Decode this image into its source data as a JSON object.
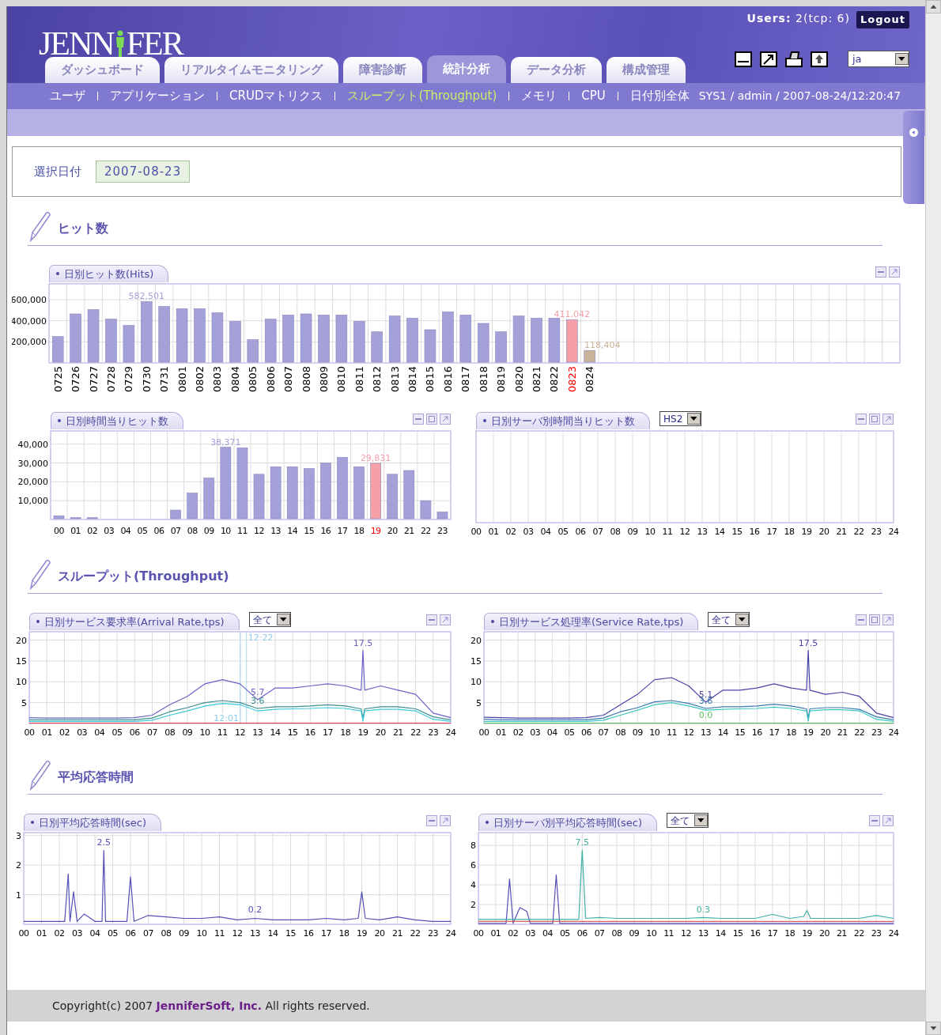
{
  "header": {
    "logo": {
      "left": "JENN",
      "right": "FER"
    },
    "users": "**Users:** 2(tcp: 6)",
    "logout": "Logout",
    "language": "ja"
  },
  "tabs": [
    {
      "label": "ダッシュボード",
      "selected": false
    },
    {
      "label": "リアルタイムモニタリング",
      "selected": false
    },
    {
      "label": "障害診断",
      "selected": false
    },
    {
      "label": "統計分析",
      "selected": true
    },
    {
      "label": "データ分析",
      "selected": false
    },
    {
      "label": "構成管理",
      "selected": false
    }
  ],
  "subnav": [
    {
      "label": "ユーザ",
      "selected": false
    },
    {
      "label": "アプリケーション",
      "selected": false
    },
    {
      "label": "CRUDマトリクス",
      "selected": false
    },
    {
      "label": "スループット(Throughput)",
      "selected": true
    },
    {
      "label": "メモリ",
      "selected": false
    },
    {
      "label": "CPU",
      "selected": false
    },
    {
      "label": "日付別全体",
      "selected": false
    }
  ],
  "session": "SYS1 / admin / 2007-08-24/12:20:47",
  "date_filter": {
    "label": "選択日付",
    "value": "2007-08-23"
  },
  "sections": [
    {
      "title": "ヒット数",
      "panels": [
        {
          "title": "日別ヒット数(Hits)",
          "buttons": [
            {
              "kind": "minimize"
            },
            {
              "kind": "maximize"
            }
          ],
          "chart_data": {
            "type": "bar",
            "stacked": true,
            "grid": true,
            "categories": [
              "0725",
              "0726",
              "0727",
              "0728",
              "0729",
              "0730",
              "0731",
              "0801",
              "0802",
              "0803",
              "0804",
              "0805",
              "0806",
              "0807",
              "0808",
              "0809",
              "0810",
              "0811",
              "0812",
              "0813",
              "0814",
              "0815",
              "0816",
              "0817",
              "0818",
              "0819",
              "0820",
              "0821",
              "0822",
              "0823",
              "0824"
            ],
            "series": [
              {
                "color": "#a4a1d8",
                "values": [
                  250000,
                  465000,
                  505000,
                  415000,
                  355000,
                  582501,
                  535000,
                  515000,
                  515000,
                  475000,
                  395000,
                  220000,
                  415000,
                  455000,
                  465000,
                  455000,
                  455000,
                  395000,
                  295000,
                  445000,
                  425000,
                  315000,
                  485000,
                  455000,
                  375000,
                  295000,
                  445000,
                  425000,
                  425000,
                  null,
                  null
                ]
              },
              {
                "color": "#f4a0a6",
                "values": [
                  null,
                  null,
                  null,
                  null,
                  null,
                  null,
                  null,
                  null,
                  null,
                  null,
                  null,
                  null,
                  null,
                  null,
                  null,
                  null,
                  null,
                  null,
                  null,
                  null,
                  null,
                  null,
                  null,
                  null,
                  null,
                  null,
                  null,
                  null,
                  null,
                  411042,
                  null
                ]
              },
              {
                "color": "#c8b498",
                "values": [
                  null,
                  null,
                  null,
                  null,
                  null,
                  null,
                  null,
                  null,
                  null,
                  null,
                  null,
                  null,
                  null,
                  null,
                  null,
                  null,
                  null,
                  null,
                  null,
                  null,
                  null,
                  null,
                  null,
                  null,
                  null,
                  null,
                  null,
                  null,
                  null,
                  null,
                  118404
                ]
              }
            ],
            "ylim": [
              0,
              750000
            ],
            "yticks": [
              {
                "value": 200000,
                "label": "200,000"
              },
              {
                "value": 400000,
                "label": "400,000"
              },
              {
                "value": 600000,
                "label": "600,000"
              }
            ],
            "annotations": [
              {
                "x": "0730",
                "y": 582501,
                "text": "582,501"
              },
              {
                "x": "0823",
                "y": 411042,
                "text": "411,042"
              },
              {
                "x": "0824",
                "y": 118404,
                "text": "118,404"
              }
            ]
          }
        },
        {
          "title": "日別時間当りヒット数",
          "buttons": [
            {
              "kind": "minimize"
            },
            {
              "kind": "restore"
            },
            {
              "kind": "maximize"
            }
          ],
          "chart_data": {
            "type": "bar",
            "stacked": true,
            "grid": true,
            "categories": [
              "00",
              "01",
              "02",
              "03",
              "04",
              "05",
              "06",
              "07",
              "08",
              "09",
              "10",
              "11",
              "12",
              "13",
              "14",
              "15",
              "16",
              "17",
              "18",
              "19",
              "20",
              "21",
              "22",
              "23"
            ],
            "series": [
              {
                "color": "#a4a1d8",
                "values": [
                  2000,
                  1000,
                  1000,
                  0,
                  0,
                  0,
                  0,
                  5000,
                  14000,
                  22000,
                  38371,
                  38000,
                  24000,
                  28000,
                  28000,
                  27000,
                  30000,
                  33000,
                  28000,
                  null,
                  24000,
                  26000,
                  10000,
                  4000
                ]
              },
              {
                "color": "#f4a0a6",
                "values": [
                  null,
                  null,
                  null,
                  null,
                  null,
                  null,
                  null,
                  null,
                  null,
                  null,
                  null,
                  null,
                  null,
                  null,
                  null,
                  null,
                  null,
                  null,
                  null,
                  29831,
                  null,
                  null,
                  null,
                  null
                ]
              }
            ],
            "ylim": [
              0,
              47000
            ],
            "yticks": [
              {
                "value": 10000,
                "label": "10,000"
              },
              {
                "value": 20000,
                "label": "20,000"
              },
              {
                "value": 30000,
                "label": "30,000"
              },
              {
                "value": 40000,
                "label": "40,000"
              }
            ],
            "annotations": [
              {
                "x": "10",
                "y": 38371,
                "text": "38,371"
              },
              {
                "x": "19",
                "y": 29831,
                "text": "29,831"
              }
            ]
          }
        },
        {
          "title": "日別サーバ別時間当りヒット数",
          "filter": "HS2",
          "buttons": [
            {
              "kind": "minimize"
            },
            {
              "kind": "restore"
            },
            {
              "kind": "maximize"
            }
          ],
          "axis_labels": [
            "00",
            "01",
            "02",
            "03",
            "04",
            "05",
            "06",
            "07",
            "08",
            "09",
            "10",
            "11",
            "12",
            "13",
            "14",
            "15",
            "16",
            "17",
            "18",
            "19",
            "20",
            "21",
            "22",
            "23",
            "24"
          ]
        }
      ]
    },
    {
      "title": "スループット(Throughput)",
      "panels": [
        {
          "title": "日別サービス要求率(Arrival Rate,tps)",
          "filter": "全て",
          "buttons": [
            {
              "kind": "minimize"
            },
            {
              "kind": "maximize"
            }
          ],
          "chart_data": {
            "type": "line",
            "grid": true,
            "xlim": [
              0,
              24
            ],
            "ylim": [
              0,
              22
            ],
            "yticks": [
              5,
              10,
              15,
              20
            ],
            "x": [
              0,
              1,
              2,
              3,
              4,
              5,
              6,
              7,
              8,
              9,
              10,
              11,
              12,
              13,
              14,
              15,
              16,
              17,
              18,
              18.9,
              19,
              19.1,
              20,
              21,
              22,
              23,
              24
            ],
            "ref_lines": [
              {
                "axis": "x",
                "value": 12.37,
                "label": "12:22"
              },
              {
                "axis": "x",
                "value": 12.02,
                "label": "12:01"
              }
            ],
            "series": [
              {
                "color": "#6a62c8",
                "values": [
                  1.4,
                  1.3,
                  1.3,
                  1.3,
                  1.3,
                  1.3,
                  1.4,
                  2,
                  4.5,
                  6.5,
                  9.5,
                  10.5,
                  9.5,
                  5.7,
                  8.5,
                  8.5,
                  9,
                  9.5,
                  9,
                  8,
                  17.5,
                  8,
                  9,
                  8,
                  7,
                  2.5,
                  1.4
                ]
              },
              {
                "color": "#3d8f8f",
                "values": [
                  0.9,
                  0.9,
                  0.9,
                  0.9,
                  0.9,
                  0.9,
                  0.9,
                  1.3,
                  2.8,
                  3.8,
                  5,
                  5.5,
                  5,
                  3.6,
                  4,
                  4,
                  4.2,
                  4.5,
                  4.2,
                  3.5,
                  1.2,
                  3.5,
                  4,
                  4,
                  3.5,
                  1.6,
                  0.9
                ]
              },
              {
                "color": "#3cc8d8",
                "values": [
                  0.5,
                  0.5,
                  0.5,
                  0.5,
                  0.5,
                  0.5,
                  0.5,
                  0.8,
                  2,
                  3,
                  4.2,
                  4.8,
                  4.5,
                  3,
                  3.4,
                  3.5,
                  3.6,
                  3.8,
                  3.6,
                  3,
                  0.6,
                  3,
                  3.4,
                  3.4,
                  3,
                  1,
                  0.5
                ]
              },
              {
                "color": "#e84040",
                "values": [
                  0.1,
                  0.1,
                  0.1,
                  0.1,
                  0.1,
                  0.1,
                  0.1,
                  0.1,
                  0.1,
                  0.1,
                  0.1,
                  0.1,
                  0.1,
                  0.1,
                  0.1,
                  0.1,
                  0.1,
                  0.1,
                  0.1,
                  0.1,
                  0.1,
                  0.1,
                  0.1,
                  0.1,
                  0.1,
                  0.1,
                  0.1
                ]
              }
            ],
            "xticks": [
              {
                "value": 0,
                "label": "00"
              },
              {
                "value": 1,
                "label": "01"
              },
              {
                "value": 2,
                "label": "02"
              },
              {
                "value": 3,
                "label": "03"
              },
              {
                "value": 4,
                "label": "04"
              },
              {
                "value": 5,
                "label": "05"
              },
              {
                "value": 6,
                "label": "06"
              },
              {
                "value": 7,
                "label": "07"
              },
              {
                "value": 8,
                "label": "08"
              },
              {
                "value": 9,
                "label": "09"
              },
              {
                "value": 10,
                "label": "10"
              },
              {
                "value": 11,
                "label": "11"
              },
              {
                "value": 12,
                "label": "12"
              },
              {
                "value": 13,
                "label": "13"
              },
              {
                "value": 14,
                "label": "14"
              },
              {
                "value": 15,
                "label": "15"
              },
              {
                "value": 16,
                "label": "16"
              },
              {
                "value": 17,
                "label": "17"
              },
              {
                "value": 18,
                "label": "18"
              },
              {
                "value": 19,
                "label": "19"
              },
              {
                "value": 20,
                "label": "20"
              },
              {
                "value": 21,
                "label": "21"
              },
              {
                "value": 22,
                "label": "22"
              },
              {
                "value": 23,
                "label": "23"
              },
              {
                "value": 24,
                "label": "24"
              }
            ],
            "annotations": [
              {
                "x": 19,
                "y": 17.5,
                "text": "17.5"
              },
              {
                "x": 13,
                "y": 5.7,
                "text": "5.7"
              },
              {
                "x": 13,
                "y": 3.6,
                "text": "3.6"
              }
            ]
          }
        },
        {
          "title": "日別サービス処理率(Service Rate,tps)",
          "filter": "全て",
          "buttons": [
            {
              "kind": "minimize"
            },
            {
              "kind": "restore"
            },
            {
              "kind": "maximize"
            }
          ],
          "chart_data": {
            "type": "line",
            "grid": true,
            "xlim": [
              0,
              24
            ],
            "ylim": [
              0,
              22
            ],
            "yticks": [
              5,
              10,
              15,
              20
            ],
            "x": [
              0,
              1,
              2,
              3,
              4,
              5,
              6,
              7,
              8,
              9,
              10,
              11,
              12,
              13,
              14,
              15,
              16,
              17,
              18,
              18.9,
              19,
              19.1,
              20,
              21,
              22,
              23,
              24
            ],
            "series": [
              {
                "color": "#4a44a8",
                "values": [
                  1.5,
                  1.4,
                  1.3,
                  1.3,
                  1.3,
                  1.3,
                  1.4,
                  2,
                  4.5,
                  7,
                  10.5,
                  11,
                  9,
                  5.1,
                  8,
                  8,
                  8.5,
                  9.5,
                  8.5,
                  8,
                  17.5,
                  8,
                  7,
                  7.5,
                  6.5,
                  2.5,
                  1.4
                ]
              },
              {
                "color": "#3a7ab0",
                "values": [
                  1,
                  0.9,
                  0.9,
                  0.9,
                  0.9,
                  0.9,
                  0.9,
                  1.3,
                  2.8,
                  3.8,
                  5.2,
                  5.5,
                  4.8,
                  3.6,
                  4,
                  4,
                  4.2,
                  4.6,
                  4.2,
                  3.5,
                  1.2,
                  3.5,
                  3.8,
                  3.8,
                  3.4,
                  1.6,
                  0.9
                ]
              },
              {
                "color": "#3cc8c0",
                "values": [
                  0.5,
                  0.5,
                  0.5,
                  0.5,
                  0.5,
                  0.5,
                  0.5,
                  0.8,
                  2,
                  3.2,
                  4.5,
                  5,
                  4.2,
                  3.2,
                  3.4,
                  3.5,
                  3.6,
                  3.9,
                  3.6,
                  3,
                  0.6,
                  3,
                  3.3,
                  3.3,
                  3,
                  1,
                  0.5
                ]
              },
              {
                "color": "#5cc05c",
                "values": [
                  0.1,
                  0.1,
                  0.1,
                  0.1,
                  0.1,
                  0.1,
                  0.1,
                  0.1,
                  0.1,
                  0.1,
                  0.1,
                  0.1,
                  0.1,
                  0.1,
                  0.1,
                  0.1,
                  0.1,
                  0.1,
                  0.1,
                  0.1,
                  0.1,
                  0.1,
                  0.1,
                  0.1,
                  0.1,
                  0.1,
                  0.1
                ]
              }
            ],
            "xticks": [
              {
                "value": 0,
                "label": "00"
              },
              {
                "value": 1,
                "label": "01"
              },
              {
                "value": 2,
                "label": "02"
              },
              {
                "value": 3,
                "label": "03"
              },
              {
                "value": 4,
                "label": "04"
              },
              {
                "value": 5,
                "label": "05"
              },
              {
                "value": 6,
                "label": "06"
              },
              {
                "value": 7,
                "label": "07"
              },
              {
                "value": 8,
                "label": "08"
              },
              {
                "value": 9,
                "label": "09"
              },
              {
                "value": 10,
                "label": "10"
              },
              {
                "value": 11,
                "label": "11"
              },
              {
                "value": 12,
                "label": "12"
              },
              {
                "value": 13,
                "label": "13"
              },
              {
                "value": 14,
                "label": "14"
              },
              {
                "value": 15,
                "label": "15"
              },
              {
                "value": 16,
                "label": "16"
              },
              {
                "value": 17,
                "label": "17"
              },
              {
                "value": 18,
                "label": "18"
              },
              {
                "value": 19,
                "label": "19"
              },
              {
                "value": 20,
                "label": "20"
              },
              {
                "value": 21,
                "label": "21"
              },
              {
                "value": 22,
                "label": "22"
              },
              {
                "value": 23,
                "label": "23"
              },
              {
                "value": 24,
                "label": "24"
              }
            ],
            "annotations": [
              {
                "x": 19,
                "y": 17.5,
                "text": "17.5"
              },
              {
                "x": 13,
                "y": 5.1,
                "text": "5.1"
              },
              {
                "x": 13,
                "y": 3.6,
                "text": "3.6"
              },
              {
                "x": 13,
                "y": 0.1,
                "text": "0.0"
              }
            ]
          }
        }
      ]
    },
    {
      "title": "平均応答時間",
      "panels": [
        {
          "title": "日別平均応答時間(sec)",
          "buttons": [
            {
              "kind": "minimize"
            },
            {
              "kind": "maximize"
            }
          ],
          "chart_data": {
            "type": "line",
            "grid": true,
            "xlim": [
              0,
              24
            ],
            "ylim": [
              0,
              3.1
            ],
            "yticks": [
              1,
              2,
              3
            ],
            "x": [
              0,
              1,
              2,
              2.3,
              2.5,
              2.6,
              2.8,
              3,
              3.4,
              4,
              4.4,
              4.5,
              4.6,
              5,
              5.8,
              6,
              6.2,
              7,
              8,
              9,
              10,
              11,
              12,
              13,
              14,
              15,
              16,
              17,
              18,
              18.8,
              19,
              19.2,
              20,
              21,
              22,
              23,
              24
            ],
            "series": [
              {
                "color": "#5550b8",
                "values": [
                  0.1,
                  0.1,
                  0.1,
                  0.1,
                  1.7,
                  0.1,
                  1.1,
                  0.1,
                  0.35,
                  0.1,
                  0.1,
                  2.5,
                  0.1,
                  0.1,
                  0.1,
                  1.6,
                  0.1,
                  0.3,
                  0.25,
                  0.2,
                  0.2,
                  0.25,
                  0.15,
                  0.2,
                  0.15,
                  0.15,
                  0.15,
                  0.2,
                  0.15,
                  0.2,
                  1.1,
                  0.2,
                  0.15,
                  0.25,
                  0.15,
                  0.1,
                  0.1
                ]
              }
            ],
            "xticks": [
              {
                "value": 0,
                "label": "00"
              },
              {
                "value": 1,
                "label": "01"
              },
              {
                "value": 2,
                "label": "02"
              },
              {
                "value": 3,
                "label": "03"
              },
              {
                "value": 4,
                "label": "04"
              },
              {
                "value": 5,
                "label": "05"
              },
              {
                "value": 6,
                "label": "06"
              },
              {
                "value": 7,
                "label": "07"
              },
              {
                "value": 8,
                "label": "08"
              },
              {
                "value": 9,
                "label": "09"
              },
              {
                "value": 10,
                "label": "10"
              },
              {
                "value": 11,
                "label": "11"
              },
              {
                "value": 12,
                "label": "12"
              },
              {
                "value": 13,
                "label": "13"
              },
              {
                "value": 14,
                "label": "14"
              },
              {
                "value": 15,
                "label": "15"
              },
              {
                "value": 16,
                "label": "16"
              },
              {
                "value": 17,
                "label": "17"
              },
              {
                "value": 18,
                "label": "18"
              },
              {
                "value": 19,
                "label": "19"
              },
              {
                "value": 20,
                "label": "20"
              },
              {
                "value": 21,
                "label": "21"
              },
              {
                "value": 22,
                "label": "22"
              },
              {
                "value": 23,
                "label": "23"
              },
              {
                "value": 24,
                "label": "24"
              }
            ],
            "annotations": [
              {
                "x": 4.5,
                "y": 2.5,
                "text": "2.5"
              },
              {
                "x": 13,
                "y": 0.25,
                "text": "0.2"
              }
            ]
          }
        },
        {
          "title": "日別サーバ別平均応答時間(sec)",
          "filter": "全て",
          "buttons": [
            {
              "kind": "minimize"
            },
            {
              "kind": "maximize"
            }
          ],
          "chart_data": {
            "type": "line",
            "grid": true,
            "xlim": [
              0,
              24
            ],
            "ylim": [
              0,
              9.3
            ],
            "yticks": [
              2,
              4,
              6,
              8
            ],
            "x": [
              0,
              1,
              1.6,
              1.8,
              2,
              2.4,
              2.8,
              3,
              4,
              4.3,
              4.5,
              4.7,
              5,
              5.8,
              6,
              6.2,
              7,
              8,
              9,
              10,
              11,
              12,
              13,
              14,
              15,
              16,
              17,
              18,
              18.8,
              19,
              19.2,
              20,
              21,
              22,
              23,
              24
            ],
            "series": [
              {
                "color": "#5550b8",
                "values": [
                  0.1,
                  0.1,
                  0.1,
                  4.6,
                  0.1,
                  1.7,
                  1.3,
                  0.1,
                  0.1,
                  0.1,
                  5,
                  0.1,
                  0.1,
                  0.1,
                  0.1,
                  0.1,
                  0.1,
                  0.1,
                  0.1,
                  0.1,
                  0.1,
                  0.1,
                  0.1,
                  0.1,
                  0.1,
                  0.1,
                  0.1,
                  0.1,
                  0.1,
                  0.1,
                  0.1,
                  0.1,
                  0.1,
                  0.1,
                  0.1,
                  0.1
                ]
              },
              {
                "color": "#40b0a0",
                "values": [
                  0.5,
                  0.5,
                  0.5,
                  0.5,
                  0.5,
                  0.5,
                  0.5,
                  0.5,
                  0.5,
                  0.5,
                  0.5,
                  0.5,
                  0.5,
                  0.5,
                  7.5,
                  0.6,
                  0.7,
                  0.6,
                  0.6,
                  0.6,
                  0.6,
                  0.6,
                  0.7,
                  0.6,
                  0.6,
                  0.6,
                  1,
                  0.6,
                  0.8,
                  1.4,
                  0.6,
                  0.6,
                  0.6,
                  0.6,
                  0.9,
                  0.6
                ]
              },
              {
                "color": "#e06060",
                "values": [
                  0.3,
                  0.3,
                  0.3,
                  0.3,
                  0.3,
                  0.3,
                  0.3,
                  0.3,
                  0.3,
                  0.3,
                  0.3,
                  0.3,
                  0.3,
                  0.3,
                  0.3,
                  0.3,
                  0.3,
                  0.3,
                  0.3,
                  0.3,
                  0.3,
                  0.3,
                  0.3,
                  0.3,
                  0.3,
                  0.3,
                  0.3,
                  0.3,
                  0.3,
                  0.3,
                  0.3,
                  0.3,
                  0.3,
                  0.3,
                  0.3,
                  0.3
                ]
              }
            ],
            "xticks": [
              {
                "value": 0,
                "label": "00"
              },
              {
                "value": 1,
                "label": "01"
              },
              {
                "value": 2,
                "label": "02"
              },
              {
                "value": 3,
                "label": "03"
              },
              {
                "value": 4,
                "label": "04"
              },
              {
                "value": 5,
                "label": "05"
              },
              {
                "value": 6,
                "label": "06"
              },
              {
                "value": 7,
                "label": "07"
              },
              {
                "value": 8,
                "label": "08"
              },
              {
                "value": 9,
                "label": "09"
              },
              {
                "value": 10,
                "label": "10"
              },
              {
                "value": 11,
                "label": "11"
              },
              {
                "value": 12,
                "label": "12"
              },
              {
                "value": 13,
                "label": "13"
              },
              {
                "value": 14,
                "label": "14"
              },
              {
                "value": 15,
                "label": "15"
              },
              {
                "value": 16,
                "label": "16"
              },
              {
                "value": 17,
                "label": "17"
              },
              {
                "value": 18,
                "label": "18"
              },
              {
                "value": 19,
                "label": "19"
              },
              {
                "value": 20,
                "label": "20"
              },
              {
                "value": 21,
                "label": "21"
              },
              {
                "value": 22,
                "label": "22"
              },
              {
                "value": 23,
                "label": "23"
              },
              {
                "value": 24,
                "label": "24"
              }
            ],
            "annotations": [
              {
                "x": 6,
                "y": 7.5,
                "text": "7.5"
              },
              {
                "x": 13,
                "y": 0.7,
                "text": "0.3"
              }
            ]
          }
        }
      ]
    }
  ],
  "footer": "Copyright(c) 2007 **JenniferSoft, Inc.** All rights reserved."
}
